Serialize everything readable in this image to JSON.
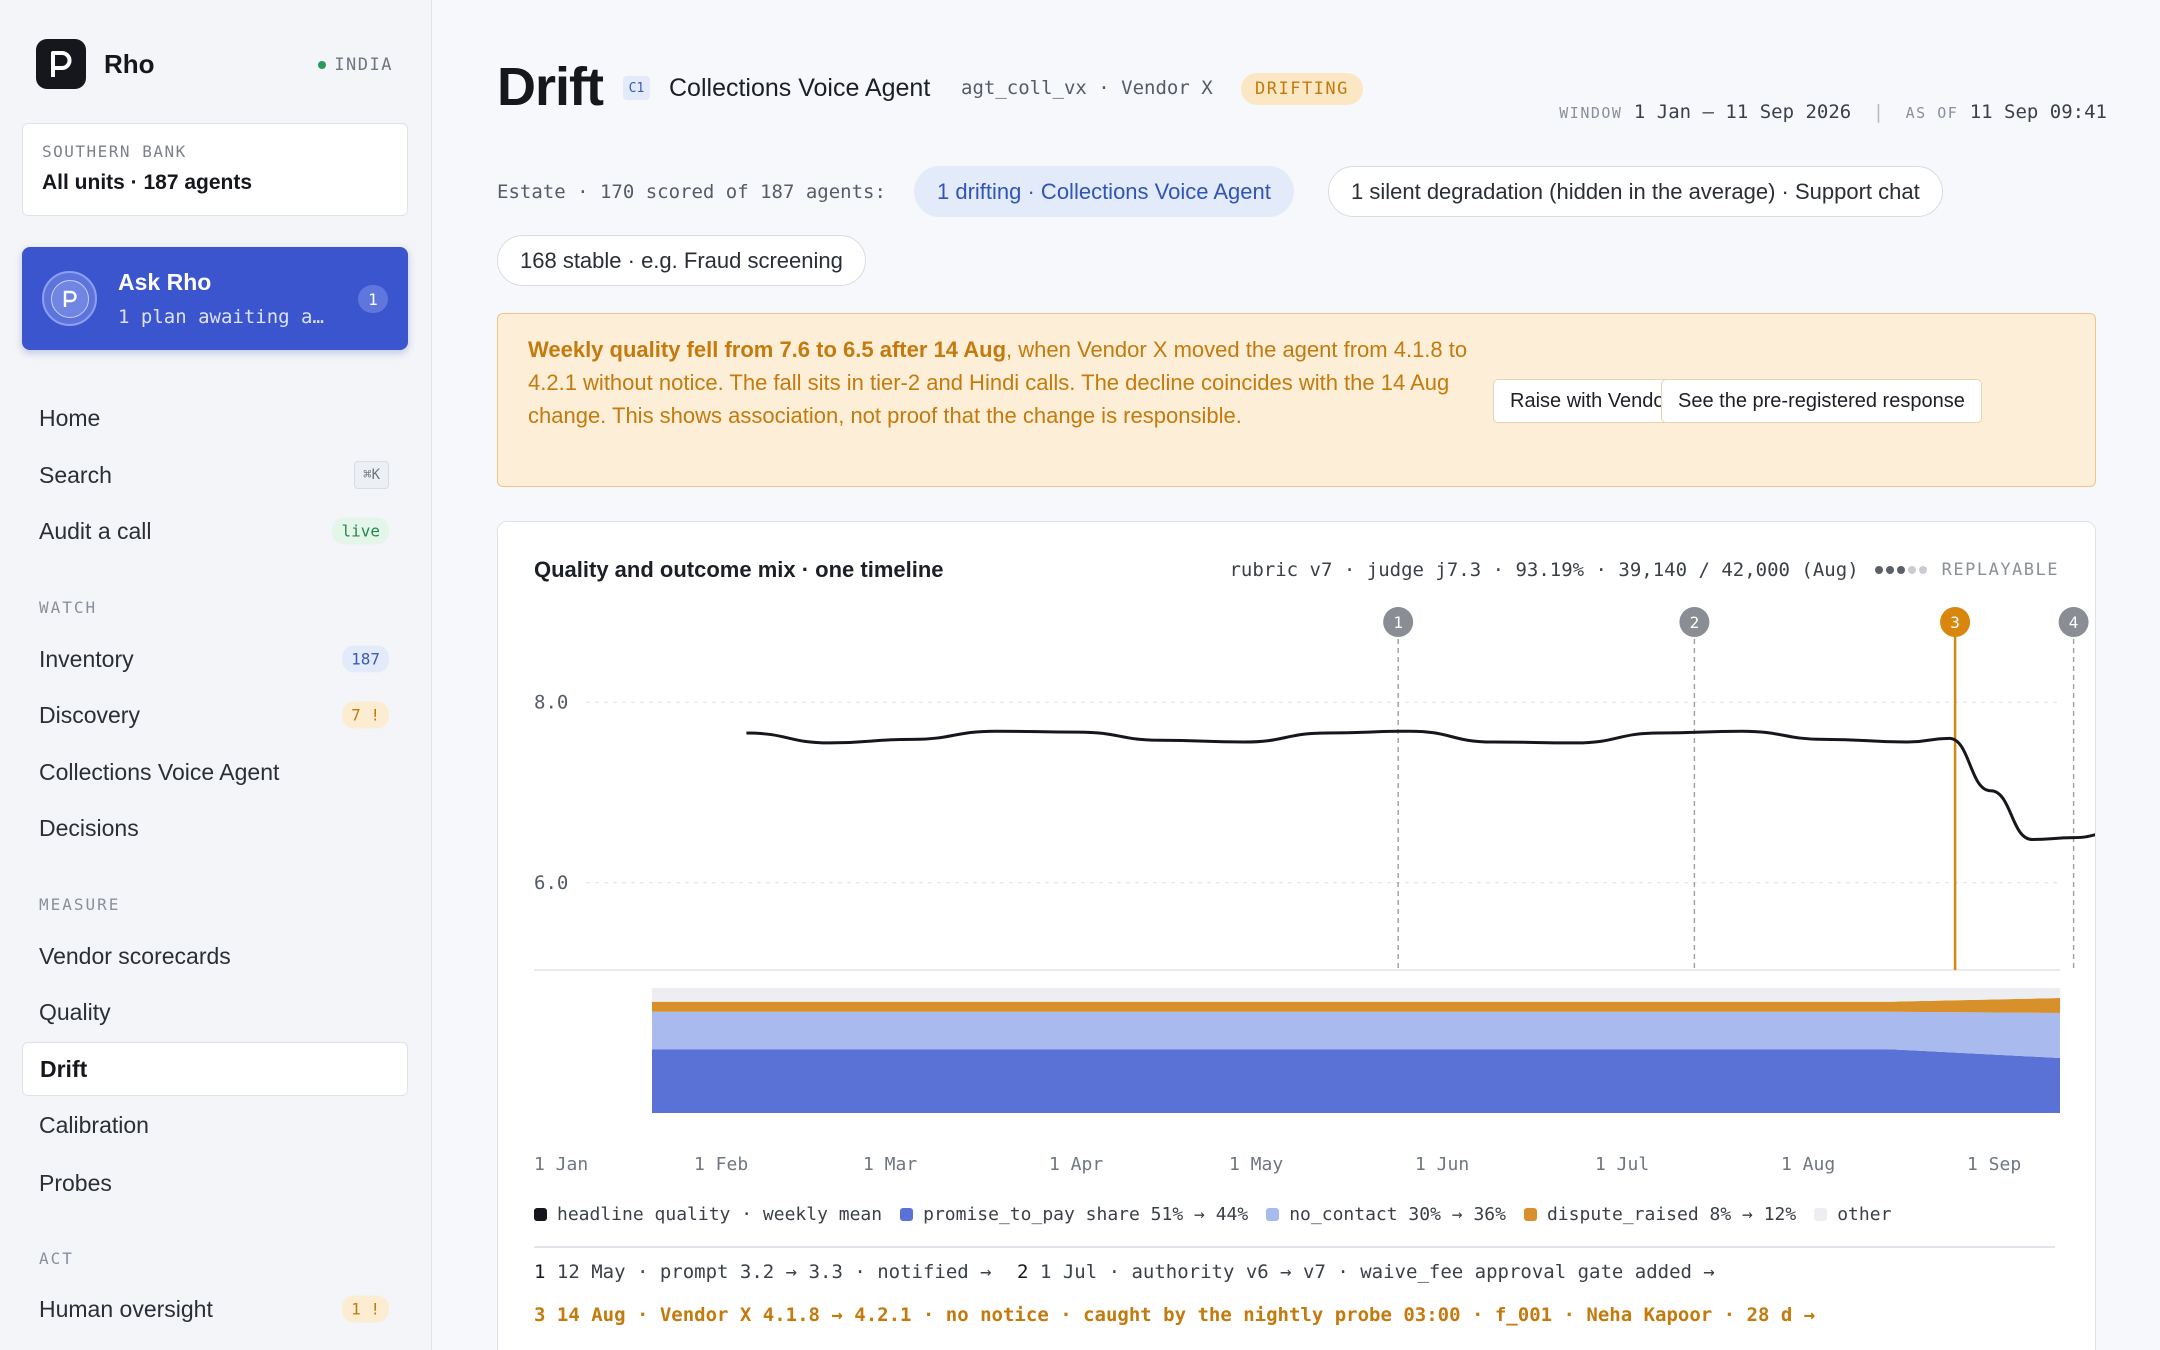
{
  "app": {
    "name": "Rho",
    "region": "INDIA"
  },
  "org": {
    "label": "SOUTHERN BANK",
    "value": "All units · 187 agents"
  },
  "ask": {
    "title": "Ask Rho",
    "subtitle": "1 plan awaiting a…",
    "badge": "1"
  },
  "nav": {
    "home": "Home",
    "search": "Search",
    "search_kbd": "⌘K",
    "audit": "Audit a call",
    "audit_badge": "live",
    "watch_label": "WATCH",
    "inventory": "Inventory",
    "inventory_badge": "187",
    "discovery": "Discovery",
    "discovery_badge": "7 !",
    "collections": "Collections Voice Agent",
    "decisions": "Decisions",
    "measure_label": "MEASURE",
    "vendor_scorecards": "Vendor scorecards",
    "quality": "Quality",
    "drift": "Drift",
    "calibration": "Calibration",
    "probes": "Probes",
    "act_label": "ACT",
    "human_oversight": "Human oversight",
    "human_oversight_badge": "1 !"
  },
  "header": {
    "title": "Drift",
    "tag": "C1",
    "agent_name": "Collections Voice Agent",
    "agent_id": "agt_coll_vx · Vendor X",
    "status": "DRIFTING",
    "window_label": "WINDOW",
    "window_value": "1 Jan – 11 Sep 2026",
    "asof_label": "AS OF",
    "asof_value": "11 Sep 09:41"
  },
  "estate": {
    "label": "Estate · 170 scored of 187 agents:",
    "drifting": "1 drifting · Collections Voice Agent",
    "silent": "1 silent degradation (hidden in the average) · Support chat",
    "stable": "168 stable · e.g. Fraud screening"
  },
  "alert": {
    "bold": "Weekly quality fell from 7.6 to 6.5 after 14 Aug",
    "rest": ", when Vendor X moved the agent from 4.1.8 to 4.2.1 without notice. The fall sits in tier-2 and Hindi calls. The decline coincides with the 14 Aug change. This shows association, not proof that the change is responsible.",
    "btn_raise": "Raise with Vendor X",
    "btn_response": "See the pre-registered response"
  },
  "chart_panel": {
    "title": "Quality and outcome mix · one timeline",
    "meta": "rubric v7 · judge j7.3 · 93.19% · 39,140 / 42,000 (Aug)",
    "replayable": "REPLAYABLE",
    "legend": {
      "quality": "headline quality · weekly mean",
      "ptp": "promise_to_pay share 51% → 44%",
      "nocontact": "no_contact 30% → 36%",
      "dispute": "dispute_raised 8% → 12%",
      "other": "other"
    },
    "events": {
      "e1_num": "1",
      "e1": "12 May · prompt 3.2 → 3.3 · notified →",
      "e2_num": "2",
      "e2": "1 Jul · authority v6 → v7 · waive_fee approval gate added →",
      "e3": "3 14 Aug · Vendor X 4.1.8 → 4.2.1 · no notice · caught by the nightly probe 03:00 · f_001 · Neha Kapoor · 28 d →"
    }
  },
  "colors": {
    "quality": "#15171c",
    "ptp": "#5a72d6",
    "nocontact": "#a9baee",
    "dispute": "#d8902a",
    "other": "#eceef1",
    "event_marker": "#8a8d93",
    "event_highlight": "#d9860e"
  },
  "chart_data": {
    "type": "line",
    "title": "Quality and outcome mix · one timeline",
    "x_ticks": [
      "1 Jan",
      "1 Feb",
      "1 Mar",
      "1 Apr",
      "1 May",
      "1 Jun",
      "1 Jul",
      "1 Aug",
      "1 Sep"
    ],
    "y_ticks": [
      "8.0",
      "6.0"
    ],
    "ylim": [
      5.0,
      9.5
    ],
    "xlim": [
      "2026-01-01",
      "2026-09-11"
    ],
    "grid": true,
    "series": [
      {
        "name": "headline quality · weekly mean",
        "x": [
          "2026-01-22",
          "2026-02-05",
          "2026-02-19",
          "2026-03-05",
          "2026-03-19",
          "2026-04-02",
          "2026-04-16",
          "2026-04-30",
          "2026-05-14",
          "2026-05-28",
          "2026-06-11",
          "2026-06-25",
          "2026-07-09",
          "2026-07-23",
          "2026-08-06",
          "2026-08-13",
          "2026-08-20",
          "2026-08-27",
          "2026-09-03",
          "2026-09-10"
        ],
        "values": [
          7.66,
          7.55,
          7.59,
          7.68,
          7.67,
          7.58,
          7.56,
          7.66,
          7.68,
          7.56,
          7.55,
          7.66,
          7.68,
          7.59,
          7.56,
          7.6,
          7.02,
          6.48,
          6.5,
          6.56
        ]
      }
    ],
    "mix": {
      "start": "2026-01-22",
      "end": "2026-09-11",
      "series": [
        {
          "name": "promise_to_pay",
          "values": [
            51,
            51,
            44
          ]
        },
        {
          "name": "no_contact",
          "values": [
            30,
            30,
            36
          ]
        },
        {
          "name": "dispute_raised",
          "values": [
            8,
            8,
            12
          ]
        },
        {
          "name": "other",
          "values": [
            11,
            11,
            8
          ]
        }
      ],
      "x": [
        "2026-01-22",
        "2026-08-14",
        "2026-09-11"
      ]
    },
    "events": [
      {
        "id": "1",
        "date": "2026-05-12"
      },
      {
        "id": "2",
        "date": "2026-07-01"
      },
      {
        "id": "3",
        "date": "2026-08-14",
        "highlight": true
      },
      {
        "id": "4",
        "date": "2026-09-03"
      }
    ]
  }
}
